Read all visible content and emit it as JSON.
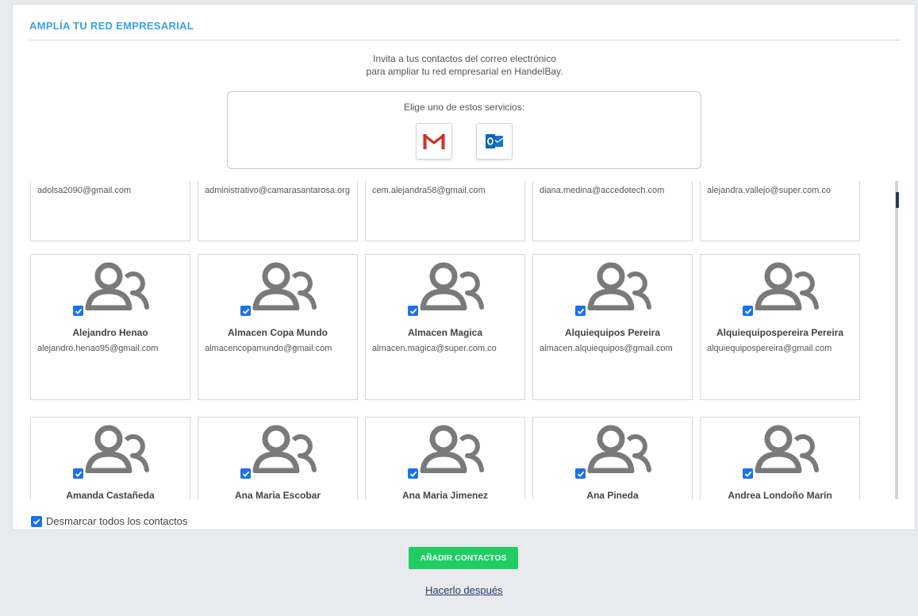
{
  "header": {
    "title": "AMPLÍA TU RED EMPRESARIAL"
  },
  "intro": {
    "line1": "Invita a tus contactos del correo electrónico",
    "line2": "para ampliar tu red empresarial en HandelBay."
  },
  "services": {
    "label": "Elige uno de estos servicios:",
    "items": [
      {
        "name": "Gmail",
        "icon": "gmail-icon"
      },
      {
        "name": "Outlook",
        "icon": "outlook-icon"
      }
    ]
  },
  "contacts": {
    "rows": [
      [
        {
          "name": "",
          "email": "adolsa2090@gmail.com",
          "checked": true
        },
        {
          "name": "",
          "email": "administrativo@camarasantarosa.org",
          "checked": true
        },
        {
          "name": "",
          "email": "cem.alejandra58@gmail.com",
          "checked": true
        },
        {
          "name": "",
          "email": "diana.medina@accedotech.com",
          "checked": true
        },
        {
          "name": "",
          "email": "alejandra.vallejo@super.com.co",
          "checked": true
        }
      ],
      [
        {
          "name": "Alejandro Henao",
          "email": "alejandro.henao95@gmail.com",
          "checked": true
        },
        {
          "name": "Almacen Copa Mundo",
          "email": "almacencopamundo@gmail.com",
          "checked": true
        },
        {
          "name": "Almacen Magica",
          "email": "almacen.magica@super.com.co",
          "checked": true
        },
        {
          "name": "Alquiequipos Pereira",
          "email": "almacen.alquiequipos@gmail.com",
          "checked": true
        },
        {
          "name": "Alquiequipospereira Pereira",
          "email": "alquiequipospereira@gmail.com",
          "checked": true
        }
      ],
      [
        {
          "name": "Amanda Castañeda",
          "email": "",
          "checked": true
        },
        {
          "name": "Ana Maria Escobar",
          "email": "",
          "checked": true
        },
        {
          "name": "Ana Maria Jimenez",
          "email": "",
          "checked": true
        },
        {
          "name": "Ana Pineda",
          "email": "",
          "checked": true
        },
        {
          "name": "Andrea Londoño Marín",
          "email": "",
          "checked": true
        }
      ]
    ]
  },
  "unmark_all": {
    "label": "Desmarcar todos los contactos",
    "checked": true
  },
  "actions": {
    "add": "AÑADIR CONTACTOS",
    "later": "Hacerlo después"
  },
  "colors": {
    "accent": "#3aa3de",
    "green": "#1fce63",
    "checkbox": "#1a73e8",
    "avatar": "#7a7a7a"
  }
}
